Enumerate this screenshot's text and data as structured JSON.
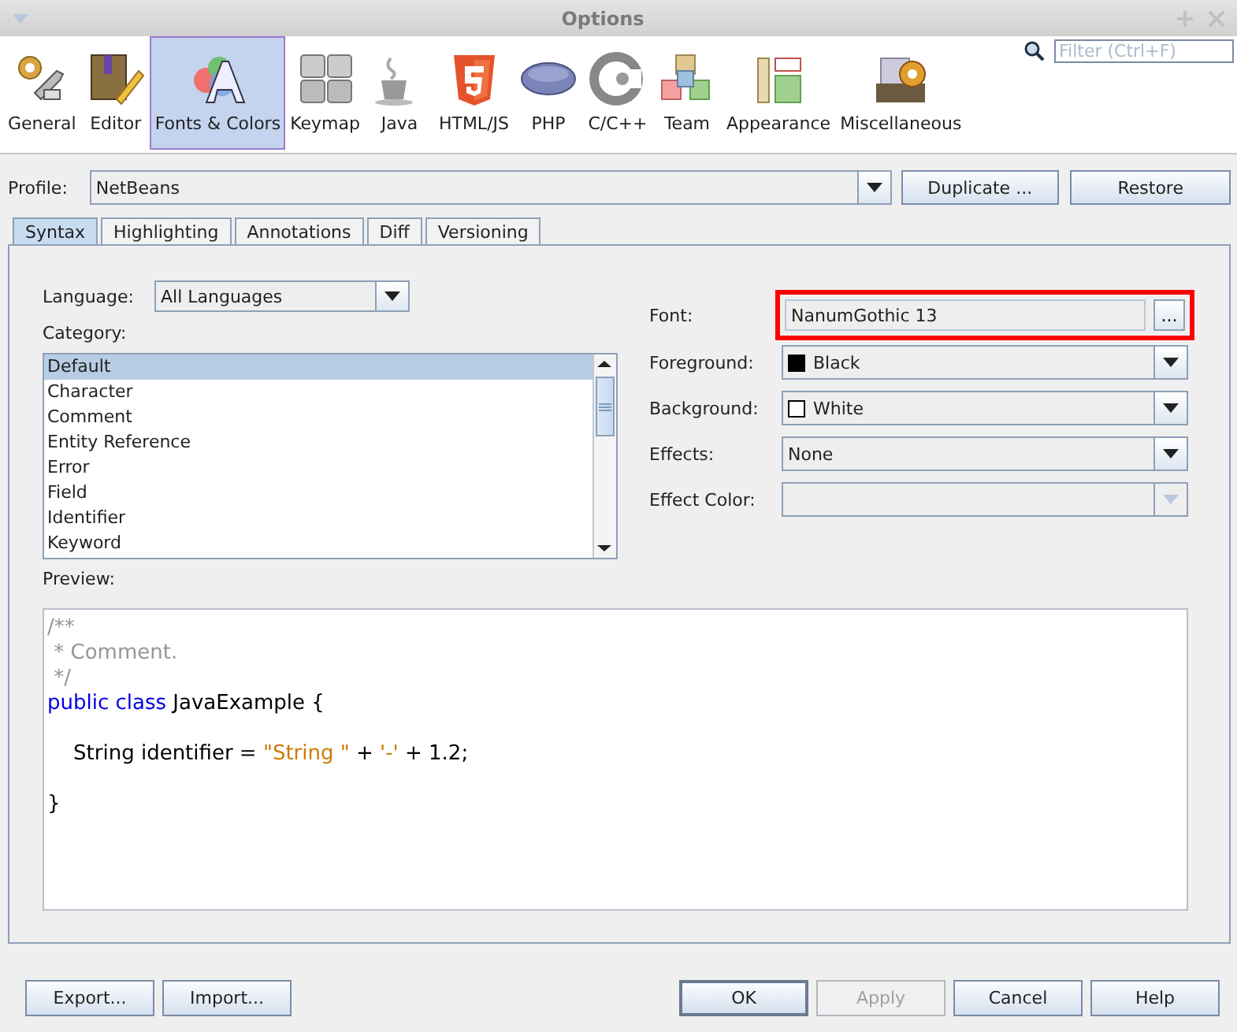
{
  "window": {
    "title": "Options"
  },
  "categories": [
    {
      "label": "General",
      "selected": false
    },
    {
      "label": "Editor",
      "selected": false
    },
    {
      "label": "Fonts & Colors",
      "selected": true
    },
    {
      "label": "Keymap",
      "selected": false
    },
    {
      "label": "Java",
      "selected": false
    },
    {
      "label": "HTML/JS",
      "selected": false
    },
    {
      "label": "PHP",
      "selected": false
    },
    {
      "label": "C/C++",
      "selected": false
    },
    {
      "label": "Team",
      "selected": false
    },
    {
      "label": "Appearance",
      "selected": false
    },
    {
      "label": "Miscellaneous",
      "selected": false
    }
  ],
  "filter": {
    "placeholder": "Filter (Ctrl+F)"
  },
  "profile": {
    "label": "Profile:",
    "value": "NetBeans",
    "buttons": [
      "Duplicate ...",
      "Restore"
    ]
  },
  "tabs": [
    {
      "label": "Syntax",
      "selected": true
    },
    {
      "label": "Highlighting",
      "selected": false
    },
    {
      "label": "Annotations",
      "selected": false
    },
    {
      "label": "Diff",
      "selected": false
    },
    {
      "label": "Versioning",
      "selected": false
    }
  ],
  "language": {
    "label": "Language:",
    "value": "All Languages"
  },
  "category": {
    "label": "Category:",
    "items": [
      {
        "label": "Default",
        "selected": true
      },
      {
        "label": "Character",
        "selected": false
      },
      {
        "label": "Comment",
        "selected": false
      },
      {
        "label": "Entity Reference",
        "selected": false
      },
      {
        "label": "Error",
        "selected": false
      },
      {
        "label": "Field",
        "selected": false
      },
      {
        "label": "Identifier",
        "selected": false
      },
      {
        "label": "Keyword",
        "selected": false
      }
    ]
  },
  "font": {
    "label": "Font:",
    "value": "NanumGothic 13",
    "button": "...",
    "highlighted": true
  },
  "properties": [
    {
      "label": "Foreground:",
      "value": "Black",
      "color": "#000000",
      "disabled": false
    },
    {
      "label": "Background:",
      "value": "White",
      "color": "#ffffff",
      "disabled": false
    },
    {
      "label": "Effects:",
      "value": "None",
      "disabled": false
    },
    {
      "label": "Effect Color:",
      "disabled": true
    }
  ],
  "preview": {
    "label": "Preview:",
    "lines": [
      {
        "kind": "code",
        "tokens": [
          {
            "kind": "comment",
            "text": "/**"
          }
        ]
      },
      {
        "kind": "code",
        "tokens": [
          {
            "kind": "comment",
            "text": " * Comment."
          }
        ]
      },
      {
        "kind": "code",
        "tokens": [
          {
            "kind": "comment",
            "text": " */"
          }
        ]
      },
      {
        "kind": "code",
        "tokens": [
          {
            "kind": "keyword",
            "text": "public class"
          },
          {
            "kind": "plain",
            "text": " JavaExample {"
          }
        ]
      },
      {
        "kind": "blank"
      },
      {
        "kind": "code",
        "tokens": [
          {
            "kind": "plain",
            "text": "    String identifier = "
          },
          {
            "kind": "string",
            "text": "\"String \""
          },
          {
            "kind": "plain",
            "text": " + "
          },
          {
            "kind": "string",
            "text": "'-'"
          },
          {
            "kind": "plain",
            "text": " + 1.2;"
          }
        ]
      },
      {
        "kind": "blank"
      },
      {
        "kind": "code",
        "tokens": [
          {
            "kind": "plain",
            "text": "}"
          }
        ]
      }
    ]
  },
  "footer": {
    "left": [
      {
        "label": "Export...",
        "disabled": false,
        "default": false
      },
      {
        "label": "Import...",
        "disabled": false,
        "default": false
      }
    ],
    "right": [
      {
        "label": "OK",
        "disabled": false,
        "default": true
      },
      {
        "label": "Apply",
        "disabled": true,
        "default": false
      },
      {
        "label": "Cancel",
        "disabled": false,
        "default": false
      },
      {
        "label": "Help",
        "disabled": false,
        "default": false
      }
    ]
  }
}
